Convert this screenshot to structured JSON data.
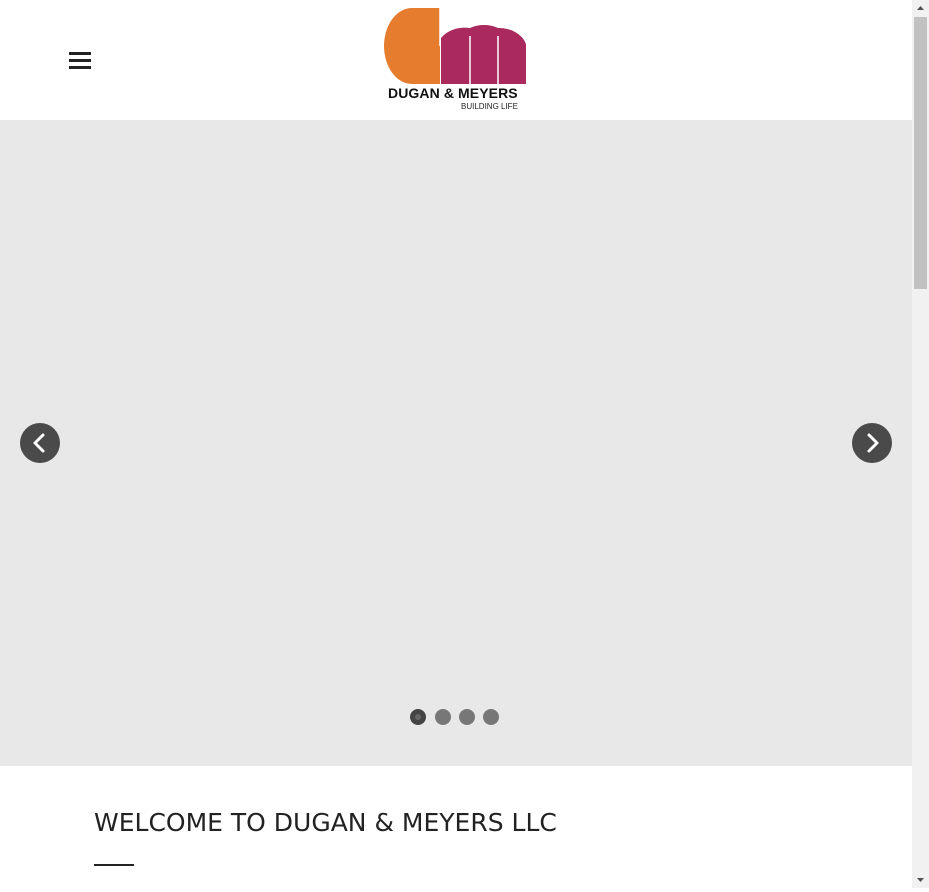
{
  "header": {
    "menu_icon": "hamburger-menu-icon",
    "logo": {
      "name": "DUGAN & MEYERS",
      "tagline": "BUILDING LIFE",
      "colors": {
        "orange": "#e67d2e",
        "magenta": "#ab2a5e"
      }
    }
  },
  "hero": {
    "background_color": "#e8e8e8",
    "prev_icon": "chevron-left-icon",
    "next_icon": "chevron-right-icon",
    "slide_count": 4,
    "active_slide": 1
  },
  "welcome": {
    "title": "WELCOME TO DUGAN & MEYERS LLC"
  }
}
